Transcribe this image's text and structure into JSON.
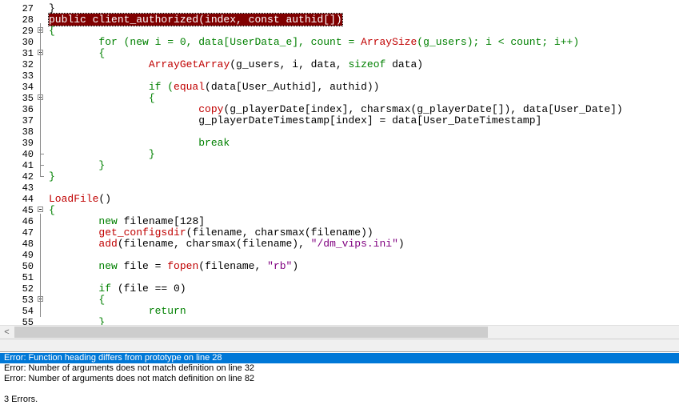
{
  "editor": {
    "lines": [
      {
        "num": "27",
        "segments": [
          {
            "t": "}",
            "c": ""
          }
        ]
      },
      {
        "num": "28",
        "highlight": true,
        "segments": [
          {
            "t": "public client_authorized(index, const authid[])",
            "c": "hl"
          }
        ]
      },
      {
        "num": "29",
        "fold": "open",
        "segments": [
          {
            "t": "{",
            "c": "green"
          }
        ]
      },
      {
        "num": "30",
        "segments": [
          {
            "t": "        for (new i = 0, data[UserData_e], count = ",
            "c": "green"
          },
          {
            "t": "ArraySize",
            "c": "red"
          },
          {
            "t": "(g_users); i < count; i++)",
            "c": "green"
          }
        ]
      },
      {
        "num": "31",
        "fold": "open",
        "segments": [
          {
            "t": "        {",
            "c": "green"
          }
        ]
      },
      {
        "num": "32",
        "segments": [
          {
            "t": "                ",
            "c": ""
          },
          {
            "t": "ArrayGetArray",
            "c": "red"
          },
          {
            "t": "(g_users, i, data, ",
            "c": ""
          },
          {
            "t": "sizeof",
            "c": "green"
          },
          {
            "t": " data)",
            "c": ""
          }
        ]
      },
      {
        "num": "33",
        "segments": [
          {
            "t": "",
            "c": ""
          }
        ]
      },
      {
        "num": "34",
        "segments": [
          {
            "t": "                if (",
            "c": "green"
          },
          {
            "t": "equal",
            "c": "red"
          },
          {
            "t": "(data[User_Authid], authid))",
            "c": ""
          }
        ]
      },
      {
        "num": "35",
        "fold": "open",
        "segments": [
          {
            "t": "                {",
            "c": "green"
          }
        ]
      },
      {
        "num": "36",
        "segments": [
          {
            "t": "                        ",
            "c": ""
          },
          {
            "t": "copy",
            "c": "red"
          },
          {
            "t": "(g_playerDate[index], charsmax(g_playerDate[]), data[User_Date])",
            "c": ""
          }
        ]
      },
      {
        "num": "37",
        "segments": [
          {
            "t": "                        g_playerDateTimestamp[index] = data[User_DateTimestamp]",
            "c": ""
          }
        ]
      },
      {
        "num": "38",
        "segments": [
          {
            "t": "",
            "c": ""
          }
        ]
      },
      {
        "num": "39",
        "segments": [
          {
            "t": "                        break",
            "c": "green"
          }
        ]
      },
      {
        "num": "40",
        "fold": "end",
        "segments": [
          {
            "t": "                }",
            "c": "green"
          }
        ]
      },
      {
        "num": "41",
        "fold": "end",
        "segments": [
          {
            "t": "        }",
            "c": "green"
          }
        ]
      },
      {
        "num": "42",
        "fold": "end",
        "segments": [
          {
            "t": "}",
            "c": "green"
          }
        ]
      },
      {
        "num": "43",
        "segments": [
          {
            "t": "",
            "c": ""
          }
        ]
      },
      {
        "num": "44",
        "segments": [
          {
            "t": "LoadFile",
            "c": "red"
          },
          {
            "t": "()",
            "c": ""
          }
        ]
      },
      {
        "num": "45",
        "fold": "open",
        "segments": [
          {
            "t": "{",
            "c": "green"
          }
        ]
      },
      {
        "num": "46",
        "segments": [
          {
            "t": "        new",
            "c": "green"
          },
          {
            "t": " filename[128]",
            "c": ""
          }
        ]
      },
      {
        "num": "47",
        "segments": [
          {
            "t": "        get_configsdir",
            "c": "red"
          },
          {
            "t": "(filename, charsmax(filename))",
            "c": ""
          }
        ]
      },
      {
        "num": "48",
        "segments": [
          {
            "t": "        add",
            "c": "red"
          },
          {
            "t": "(filename, charsmax(filename), ",
            "c": ""
          },
          {
            "t": "\"/dm_vips.ini\"",
            "c": "purple"
          },
          {
            "t": ")",
            "c": ""
          }
        ]
      },
      {
        "num": "49",
        "segments": [
          {
            "t": "",
            "c": ""
          }
        ]
      },
      {
        "num": "50",
        "segments": [
          {
            "t": "        new",
            "c": "green"
          },
          {
            "t": " file = ",
            "c": ""
          },
          {
            "t": "fopen",
            "c": "red"
          },
          {
            "t": "(filename, ",
            "c": ""
          },
          {
            "t": "\"rb\"",
            "c": "purple"
          },
          {
            "t": ")",
            "c": ""
          }
        ]
      },
      {
        "num": "51",
        "segments": [
          {
            "t": "",
            "c": ""
          }
        ]
      },
      {
        "num": "52",
        "segments": [
          {
            "t": "        if",
            "c": "green"
          },
          {
            "t": " (file == 0)",
            "c": ""
          }
        ]
      },
      {
        "num": "53",
        "fold": "open",
        "segments": [
          {
            "t": "        {",
            "c": "green"
          }
        ]
      },
      {
        "num": "54",
        "segments": [
          {
            "t": "                return",
            "c": "green"
          }
        ]
      },
      {
        "num": "55",
        "segments": [
          {
            "t": "        }",
            "c": "green"
          }
        ]
      }
    ]
  },
  "scrollbar": {
    "left_arrow": "<",
    "position": 0
  },
  "output": {
    "messages": [
      {
        "text": "Error: Function heading differs from prototype on line 28",
        "selected": true
      },
      {
        "text": "Error: Number of arguments does not match definition on line 32",
        "selected": false
      },
      {
        "text": "Error: Number of arguments does not match definition on line 82",
        "selected": false
      },
      {
        "text": "",
        "selected": false
      },
      {
        "text": "3 Errors.",
        "selected": false
      }
    ]
  },
  "colors": {
    "highlight_bg": "#800000",
    "keyword": "#008000",
    "function": "#c00000",
    "string": "#800080",
    "selection": "#0078d7"
  }
}
